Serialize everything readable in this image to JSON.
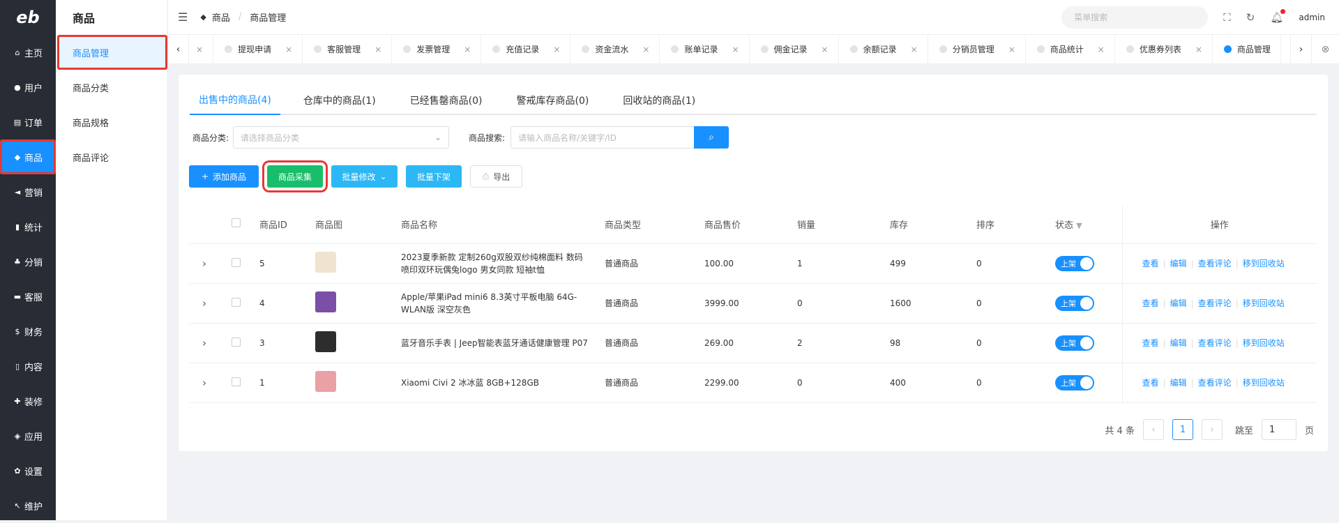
{
  "sidebar": {
    "logo": "eb",
    "items": [
      {
        "icon": "⌂",
        "label": "主页"
      },
      {
        "icon": "●",
        "label": "用户"
      },
      {
        "icon": "▤",
        "label": "订单"
      },
      {
        "icon": "◆",
        "label": "商品"
      },
      {
        "icon": "◄",
        "label": "营销"
      },
      {
        "icon": "▮",
        "label": "统计"
      },
      {
        "icon": "♣",
        "label": "分销"
      },
      {
        "icon": "▬",
        "label": "客服"
      },
      {
        "icon": "$",
        "label": "财务"
      },
      {
        "icon": "▯",
        "label": "内容"
      },
      {
        "icon": "✚",
        "label": "装修"
      },
      {
        "icon": "◈",
        "label": "应用"
      },
      {
        "icon": "✿",
        "label": "设置"
      },
      {
        "icon": "↖",
        "label": "维护"
      }
    ]
  },
  "submenu": {
    "title": "商品",
    "items": [
      "商品管理",
      "商品分类",
      "商品规格",
      "商品评论"
    ]
  },
  "topbar": {
    "breadcrumb": [
      "商品",
      "商品管理"
    ],
    "search_placeholder": "菜单搜索",
    "user": "admin"
  },
  "tabs": [
    {
      "label": ""
    },
    {
      "label": "提现申请"
    },
    {
      "label": "客服管理"
    },
    {
      "label": "发票管理"
    },
    {
      "label": "充值记录"
    },
    {
      "label": "资金流水"
    },
    {
      "label": "账单记录"
    },
    {
      "label": "佣金记录"
    },
    {
      "label": "余额记录"
    },
    {
      "label": "分销员管理"
    },
    {
      "label": "商品统计"
    },
    {
      "label": "优惠券列表"
    },
    {
      "label": "商品管理"
    }
  ],
  "product_tabs": [
    "出售中的商品(4)",
    "仓库中的商品(1)",
    "已经售罄商品(0)",
    "警戒库存商品(0)",
    "回收站的商品(1)"
  ],
  "filters": {
    "category_label": "商品分类:",
    "category_placeholder": "请选择商品分类",
    "search_label": "商品搜索:",
    "search_placeholder": "请输入商品名称/关键字/ID"
  },
  "actions": {
    "add": "添加商品",
    "collect": "商品采集",
    "batch_edit": "批量修改",
    "batch_off": "批量下架",
    "export": "导出"
  },
  "table": {
    "headers": [
      "商品ID",
      "商品图",
      "商品名称",
      "商品类型",
      "商品售价",
      "销量",
      "库存",
      "排序",
      "状态",
      "操作"
    ],
    "rows": [
      {
        "id": "5",
        "name": "2023夏季新款 定制260g双股双纱纯棉面料 数码喷印双环玩偶兔logo 男女同款 短袖t恤",
        "type": "普通商品",
        "price": "100.00",
        "sales": "1",
        "stock": "499",
        "sort": "0",
        "status": "上架",
        "thumb_color": "#efe4cf"
      },
      {
        "id": "4",
        "name": "Apple/苹果iPad mini6 8.3英寸平板电脑 64G-WLAN版 深空灰色",
        "type": "普通商品",
        "price": "3999.00",
        "sales": "0",
        "stock": "1600",
        "sort": "0",
        "status": "上架",
        "thumb_color": "#7b4fa8"
      },
      {
        "id": "3",
        "name": "蓝牙音乐手表 | Jeep智能表蓝牙通话健康管理 P07",
        "type": "普通商品",
        "price": "269.00",
        "sales": "2",
        "stock": "98",
        "sort": "0",
        "status": "上架",
        "thumb_color": "#2d2d2d"
      },
      {
        "id": "1",
        "name": "Xiaomi Civi 2 冰冰蓝 8GB+128GB",
        "type": "普通商品",
        "price": "2299.00",
        "sales": "0",
        "stock": "400",
        "sort": "0",
        "status": "上架",
        "thumb_color": "#e9a1a6"
      }
    ],
    "ops": [
      "查看",
      "编辑",
      "查看评论",
      "移到回收站"
    ]
  },
  "pager": {
    "total": "共 4 条",
    "current": "1",
    "jump_label": "跳至",
    "jump_value": "1",
    "page_unit": "页"
  }
}
